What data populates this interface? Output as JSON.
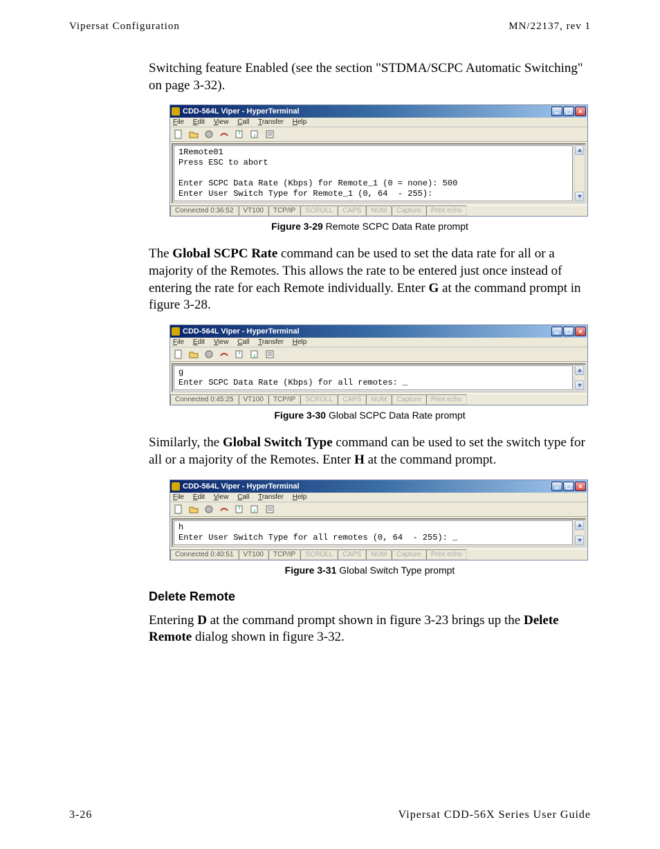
{
  "header": {
    "left": "Vipersat Configuration",
    "right": "MN/22137, rev 1"
  },
  "intro_paragraph": "Switching feature Enabled (see the section \"STDMA/SCPC Automatic Switching\" on page 3-32).",
  "terminal_common": {
    "title": "CDD-564L Viper - HyperTerminal",
    "menus": {
      "file": "File",
      "edit": "Edit",
      "view": "View",
      "call": "Call",
      "transfer": "Transfer",
      "help": "Help"
    },
    "status_labels": {
      "scroll": "SCROLL",
      "caps": "CAPS",
      "num": "NUM",
      "capture": "Capture",
      "printecho": "Print echo"
    }
  },
  "terminal_29": {
    "body_line1": "1Remote01",
    "body_line2": "Press ESC to abort",
    "body_line3": "Enter SCPC Data Rate (Kbps) for Remote_1 (0 = none): 500",
    "body_line4": "Enter User Switch Type for Remote_1 (0, 64  - 255): ",
    "status": {
      "connected": "Connected 0:36:52",
      "emulation": "VT100",
      "protocol": "TCP/IP"
    }
  },
  "figcap_29": {
    "label": "Figure 3-29",
    "text": "   Remote SCPC Data Rate prompt"
  },
  "para_after_29_pre": "The ",
  "para_after_29_bold": "Global SCPC Rate",
  "para_after_29_mid": " command can be used to set the data rate for all or a majority of the Remotes. This allows the rate to be entered just once instead of entering the rate for each Remote individually. Enter ",
  "para_after_29_bold2": "G",
  "para_after_29_post": " at the command prompt in figure 3-28.",
  "terminal_30": {
    "body_line1": "g",
    "body_line2": "Enter SCPC Data Rate (Kbps) for all remotes: _",
    "status": {
      "connected": "Connected 0:45:25",
      "emulation": "VT100",
      "protocol": "TCP/IP"
    }
  },
  "figcap_30": {
    "label": "Figure 3-30",
    "text": "   Global SCPC Data Rate prompt"
  },
  "para_after_30_pre": "Similarly, the ",
  "para_after_30_bold": "Global Switch Type",
  "para_after_30_mid": " command can be used to set the switch type for all or a majority of the Remotes. Enter ",
  "para_after_30_bold2": "H",
  "para_after_30_post": " at the command prompt.",
  "terminal_31": {
    "body_line1": "h",
    "body_line2": "Enter User Switch Type for all remotes (0, 64  - 255): _",
    "status": {
      "connected": "Connected 0:40:51",
      "emulation": "VT100",
      "protocol": "TCP/IP"
    }
  },
  "figcap_31": {
    "label": "Figure 3-31",
    "text": "   Global Switch Type prompt"
  },
  "delete_remote_heading": "Delete Remote",
  "delete_remote_para_pre": "Entering ",
  "delete_remote_para_b1": "D",
  "delete_remote_para_mid": " at the command prompt shown in figure 3-23 brings up the ",
  "delete_remote_para_b2": "Delete Remote",
  "delete_remote_para_post": " dialog shown in figure 3-32.",
  "footer": {
    "left": "3-26",
    "right": "Vipersat CDD-56X Series User Guide"
  }
}
